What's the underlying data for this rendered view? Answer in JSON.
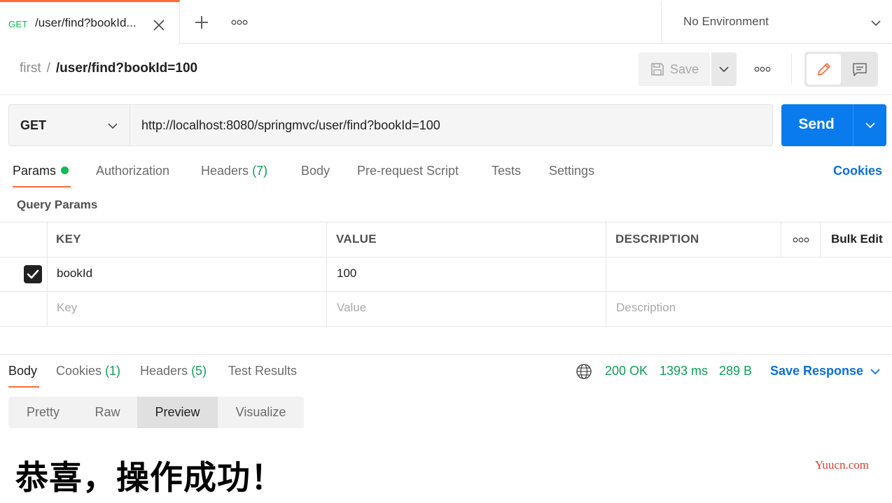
{
  "tab": {
    "method": "GET",
    "title": "/user/find?bookId...",
    "icons": [
      "close-icon",
      "plus-icon",
      "more-icon"
    ]
  },
  "environment": {
    "label": "No Environment"
  },
  "breadcrumb": {
    "parent": "first",
    "separator": "/",
    "current": "/user/find?bookId=100"
  },
  "toolbar": {
    "save_label": "Save"
  },
  "request": {
    "method": "GET",
    "url": "http://localhost:8080/springmvc/user/find?bookId=100",
    "send_label": "Send"
  },
  "request_tabs": {
    "params": "Params",
    "authorization": "Authorization",
    "headers": "Headers",
    "headers_count": "(7)",
    "body": "Body",
    "prerequest": "Pre-request Script",
    "tests": "Tests",
    "settings": "Settings",
    "cookies": "Cookies"
  },
  "query_params": {
    "title": "Query Params",
    "columns": {
      "key": "KEY",
      "value": "VALUE",
      "description": "DESCRIPTION"
    },
    "bulk_edit": "Bulk Edit",
    "rows": [
      {
        "checked": true,
        "key": "bookId",
        "value": "100",
        "description": ""
      }
    ],
    "placeholders": {
      "key": "Key",
      "value": "Value",
      "description": "Description"
    }
  },
  "response": {
    "tabs": {
      "body": "Body",
      "cookies": "Cookies",
      "cookies_count": "(1)",
      "headers": "Headers",
      "headers_count": "(5)",
      "test_results": "Test Results"
    },
    "status": "200 OK",
    "time": "1393 ms",
    "size": "289 B",
    "save_response": "Save Response",
    "views": [
      "Pretty",
      "Raw",
      "Preview",
      "Visualize"
    ],
    "active_view": "Preview",
    "content": "恭喜，操作成功！"
  },
  "watermark": "Yuucn.com",
  "colors": {
    "accent": "#ff6c37",
    "primary": "#097bed",
    "success": "#0f9d58",
    "link": "#0a6fd6"
  }
}
